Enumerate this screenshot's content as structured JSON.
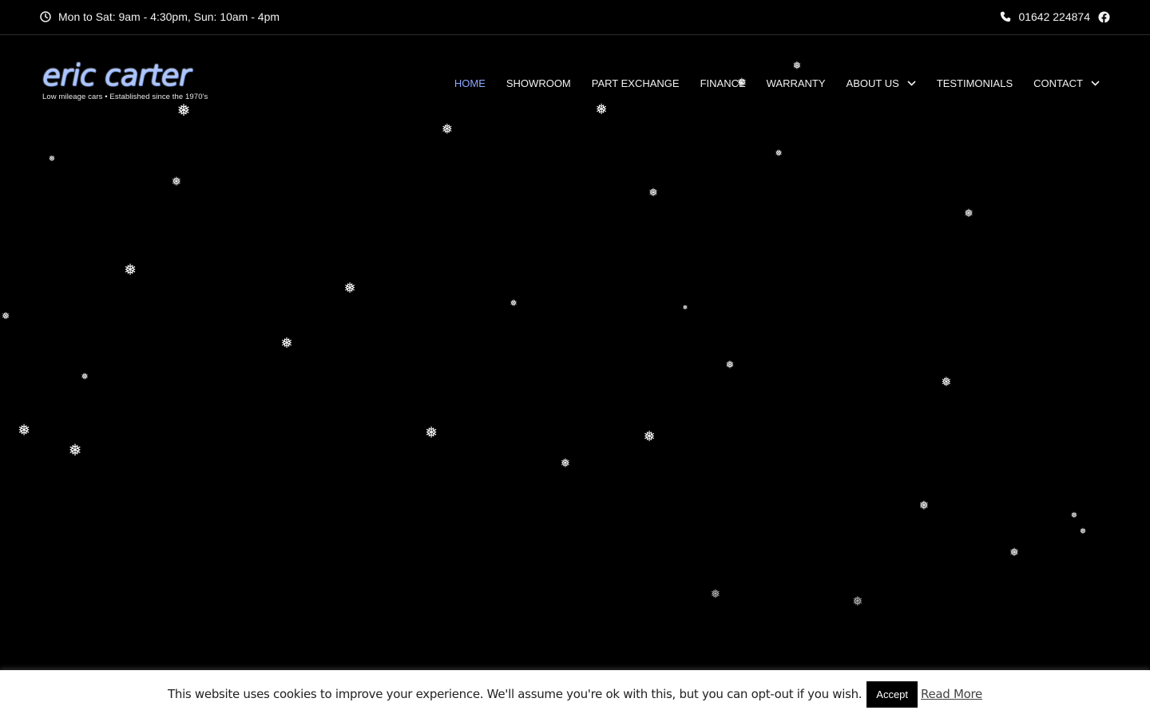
{
  "topbar": {
    "hours": "Mon to Sat: 9am - 4:30pm, Sun: 10am - 4pm",
    "hours_icon": "clock-icon",
    "phone": "01642 224874",
    "phone_icon": "phone-icon",
    "social_icon": "facebook-icon"
  },
  "logo": {
    "brand": "eric carter",
    "tagline": "Low mileage cars • Established since the 1970's"
  },
  "nav": {
    "items": [
      {
        "label": "HOME",
        "active": true
      },
      {
        "label": "SHOWROOM"
      },
      {
        "label": "PART EXCHANGE"
      },
      {
        "label": "FINANCE"
      },
      {
        "label": "WARRANTY"
      },
      {
        "label": "ABOUT US",
        "dropdown": true
      },
      {
        "label": "TESTIMONIALS"
      },
      {
        "label": "CONTACT",
        "dropdown": true
      }
    ],
    "active_color": "#8fa7ff"
  },
  "snowflake_glyph": "❅",
  "cookie": {
    "message": "This website uses cookies to improve your experience. We'll assume you're ok with this, but you can opt-out if you wish.",
    "accept": "Accept",
    "read_more": "Read More"
  }
}
